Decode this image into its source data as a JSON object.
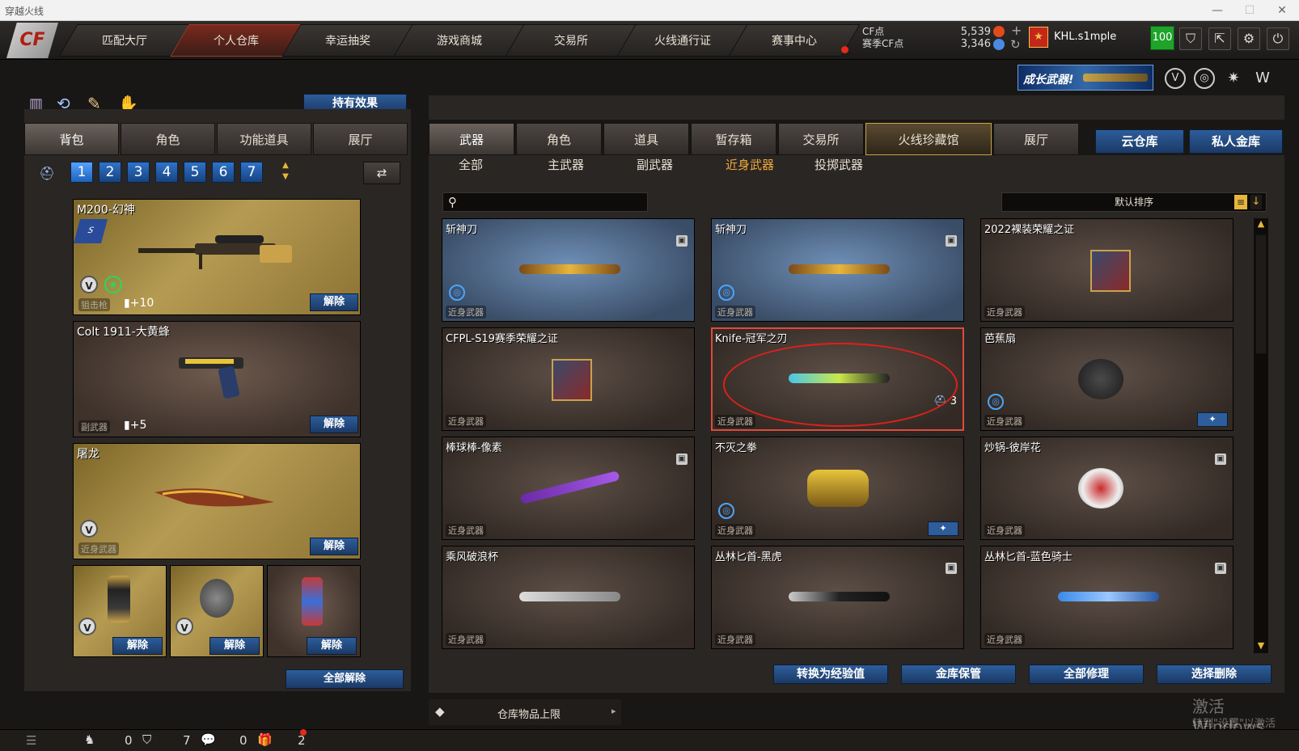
{
  "window": {
    "title": "穿越火线"
  },
  "nav": {
    "tabs": [
      "匹配大厅",
      "个人仓库",
      "幸运抽奖",
      "游戏商城",
      "交易所",
      "火线通行证",
      "赛事中心"
    ],
    "active_tab": "个人仓库",
    "cf_label": "CF点",
    "season_cf_label": "赛季CF点",
    "cf_value": "5,539",
    "season_cf_value": "3,346",
    "username": "KHL.s1mple",
    "level": "100"
  },
  "banner": {
    "text": "成长武器!"
  },
  "left": {
    "effect_button": "持有效果",
    "tabs": [
      "背包",
      "角色",
      "功能道具",
      "展厅"
    ],
    "slots": [
      "1",
      "2",
      "3",
      "4",
      "5",
      "6",
      "7"
    ],
    "equipped": [
      {
        "name": "M200-幻神",
        "tag": "狙击枪",
        "bonus": "+10",
        "release": "解除"
      },
      {
        "name": "Colt 1911-大黄蜂",
        "tag": "副武器",
        "bonus": "+5",
        "release": "解除"
      },
      {
        "name": "屠龙",
        "tag": "近身武器",
        "release": "解除"
      }
    ],
    "small_slots": [
      {
        "release": "解除"
      },
      {
        "release": "解除"
      },
      {
        "release": "解除"
      }
    ],
    "release_all": "全部解除"
  },
  "right": {
    "tabs": [
      "武器",
      "角色",
      "道具",
      "暂存箱",
      "交易所",
      "火线珍藏馆",
      "展厅"
    ],
    "cloud_buttons": [
      "云仓库",
      "私人金库"
    ],
    "subtabs": [
      "全部",
      "主武器",
      "副武器",
      "近身武器",
      "投掷武器"
    ],
    "active_subtab": "近身武器",
    "sort_label": "默认排序",
    "items": [
      {
        "name": "斩神刀",
        "tag": "近身武器",
        "style": "blue"
      },
      {
        "name": "斩神刀",
        "tag": "近身武器",
        "style": "blue"
      },
      {
        "name": "2022裸装荣耀之证",
        "tag": "近身武器",
        "style": "brown"
      },
      {
        "name": "CFPL-S19赛季荣耀之证",
        "tag": "近身武器",
        "style": "brown"
      },
      {
        "name": "Knife-冠军之刃",
        "tag": "近身武器",
        "style": "brown",
        "count": "3"
      },
      {
        "name": "芭蕉扇",
        "tag": "近身武器",
        "style": "brown"
      },
      {
        "name": "棒球棒-像素",
        "tag": "近身武器",
        "style": "brown"
      },
      {
        "name": "不灭之拳",
        "tag": "近身武器",
        "style": "brown"
      },
      {
        "name": "炒锅-彼岸花",
        "tag": "近身武器",
        "style": "brown"
      },
      {
        "name": "乘风破浪杯",
        "tag": "近身武器",
        "style": "brown"
      },
      {
        "name": "丛林匕首-黑虎",
        "tag": "近身武器",
        "style": "brown"
      },
      {
        "name": "丛林匕首-蓝色骑士",
        "tag": "近身武器",
        "style": "brown"
      }
    ],
    "actions": [
      "转换为经验值",
      "金库保管",
      "全部修理",
      "选择删除"
    ],
    "storage_limit": "仓库物品上限"
  },
  "status": {
    "c1": "0",
    "c2": "7",
    "c3": "0",
    "c4": "2"
  },
  "watermark": {
    "line1": "激活 Windows",
    "line2": "转到\"设置\"以激活"
  }
}
